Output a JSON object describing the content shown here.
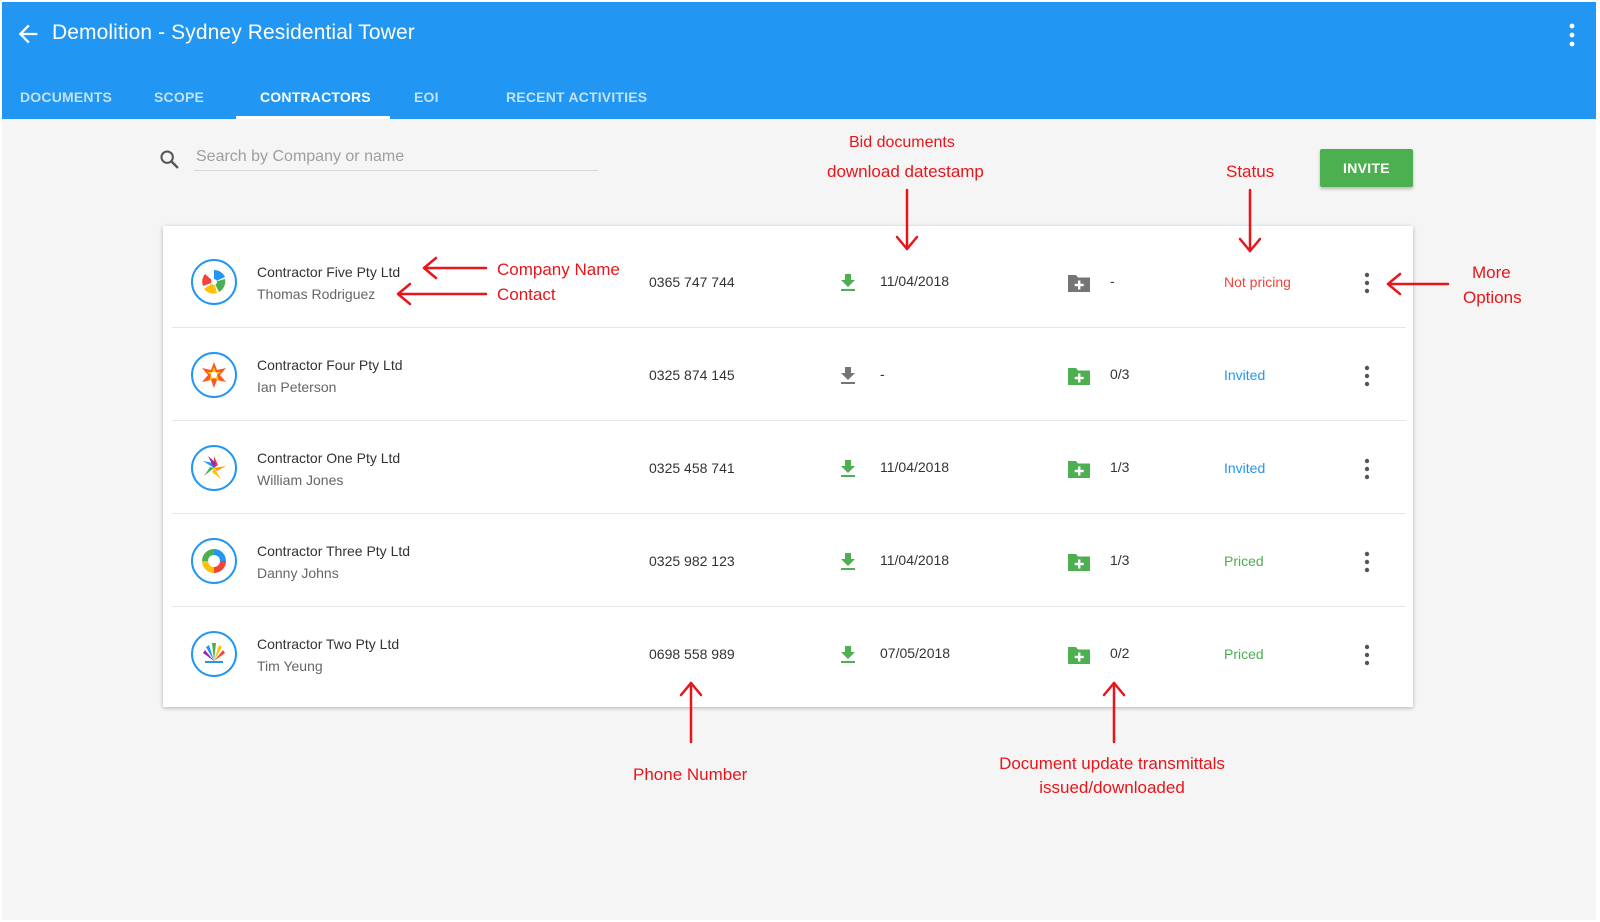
{
  "app_bar": {
    "title": "Demolition - Sydney Residential Tower",
    "tabs": [
      {
        "label": "DOCUMENTS"
      },
      {
        "label": "SCOPE"
      },
      {
        "label": "CONTRACTORS"
      },
      {
        "label": "EOI"
      },
      {
        "label": "RECENT ACTIVITIES"
      }
    ],
    "active_tab": "CONTRACTORS"
  },
  "search": {
    "placeholder": "Search by Company or name",
    "value": ""
  },
  "invite_button": "INVITE",
  "contractors": [
    {
      "company": "Contractor Five Pty Ltd",
      "contact": "Thomas Rodriguez",
      "phone": "0365 747 744",
      "download_date": "11/04/2018",
      "downloaded": true,
      "transmittals": "-",
      "has_transmittals": false,
      "status": "Not pricing",
      "status_color": "#f44336",
      "logo": "pinwheel-logo-icon"
    },
    {
      "company": "Contractor Four Pty Ltd",
      "contact": "Ian Peterson",
      "phone": "0325 874 145",
      "download_date": "-",
      "downloaded": false,
      "transmittals": "0/3",
      "has_transmittals": true,
      "status": "Invited",
      "status_color": "#2196f3",
      "logo": "star-logo-icon"
    },
    {
      "company": "Contractor One Pty Ltd",
      "contact": "William Jones",
      "phone": "0325 458 741",
      "download_date": "11/04/2018",
      "downloaded": true,
      "transmittals": "1/3",
      "has_transmittals": true,
      "status": "Invited",
      "status_color": "#2196f3",
      "logo": "flower-logo-icon"
    },
    {
      "company": "Contractor Three Pty Ltd",
      "contact": "Danny Johns",
      "phone": "0325 982 123",
      "download_date": "11/04/2018",
      "downloaded": true,
      "transmittals": "1/3",
      "has_transmittals": true,
      "status": "Priced",
      "status_color": "#4caf50",
      "logo": "ring-logo-icon"
    },
    {
      "company": "Contractor Two Pty Ltd",
      "contact": "Tim Yeung",
      "phone": "0698 558 989",
      "download_date": "07/05/2018",
      "downloaded": true,
      "transmittals": "0/2",
      "has_transmittals": true,
      "status": "Priced",
      "status_color": "#4caf50",
      "logo": "fan-logo-icon"
    }
  ],
  "colors": {
    "primary": "#2196f3",
    "accent_green": "#4caf50",
    "status_red": "#f44336",
    "annotation_red": "#e8151b",
    "icon_grey": "#757575"
  },
  "annotations": {
    "bid_documents": "Bid documents",
    "download_datestamp": "download datestamp",
    "status": "Status",
    "company_name": "Company Name",
    "contact": "Contact",
    "more": "More",
    "options": "Options",
    "phone_number": "Phone Number",
    "doc_update_1": "Document update transmittals",
    "doc_update_2": "issued/downloaded"
  }
}
